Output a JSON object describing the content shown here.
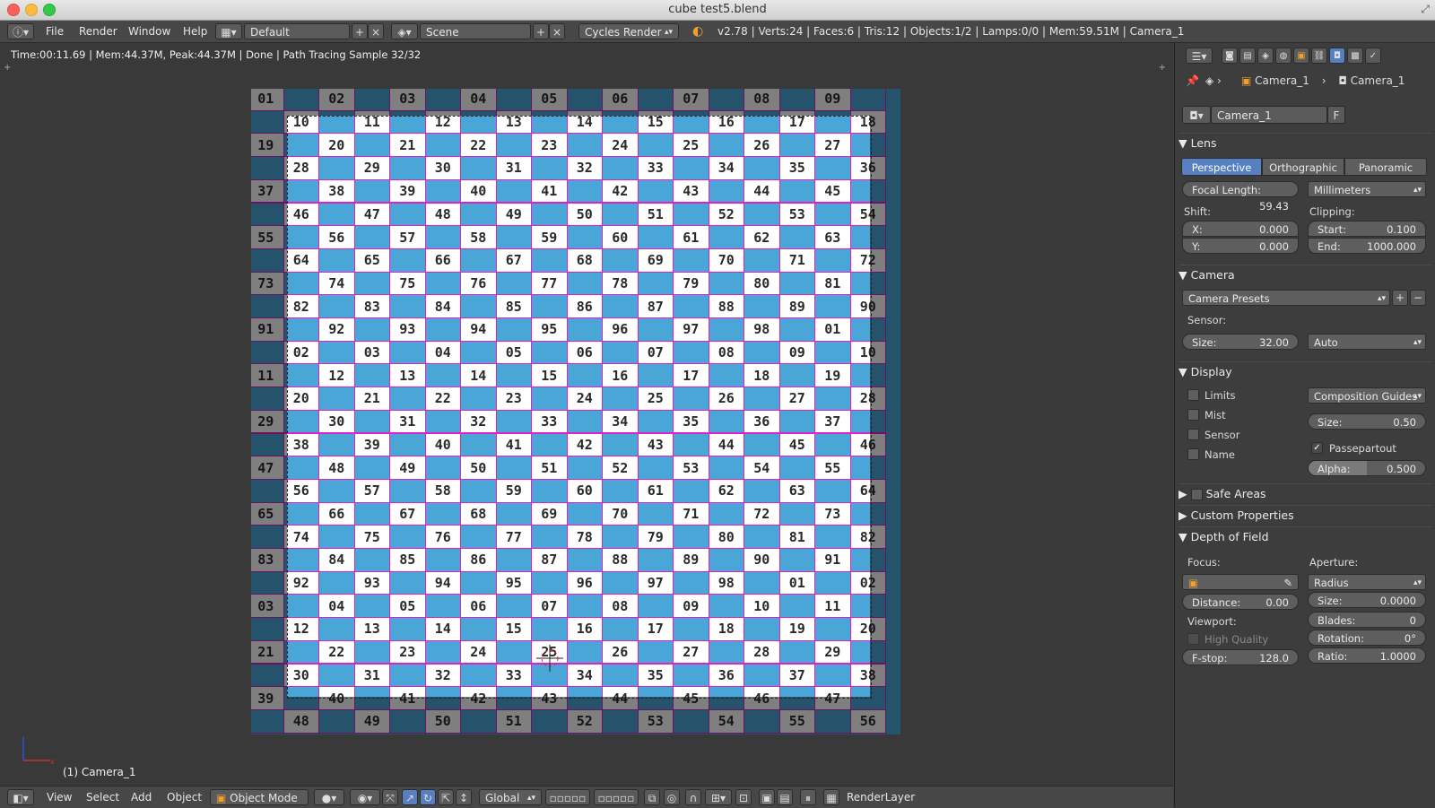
{
  "window": {
    "title": "cube test5.blend"
  },
  "infobar": {
    "menus": [
      "File",
      "Render",
      "Window",
      "Help"
    ],
    "layout": "Default",
    "scene": "Scene",
    "engine": "Cycles Render",
    "stats": "v2.78 | Verts:24 | Faces:6 | Tris:12 | Objects:1/2 | Lamps:0/0 | Mem:59.51M | Camera_1"
  },
  "viewport": {
    "status": "Time:00:11.69 | Mem:44.37M, Peak:44.37M | Done | Path Tracing Sample 32/32",
    "object_label": "(1) Camera_1",
    "grid_numbers": [
      "01",
      "02",
      "03",
      "04",
      "05",
      "06",
      "07",
      "08",
      "09",
      "10",
      "11",
      "12",
      "13",
      "14",
      "15",
      "16",
      "17",
      "18",
      "19",
      "20",
      "21",
      "22",
      "23",
      "24",
      "25",
      "26",
      "27",
      "28",
      "29",
      "30",
      "31",
      "32",
      "33",
      "34",
      "35",
      "36",
      "37",
      "38",
      "39",
      "40",
      "41",
      "42",
      "43",
      "44",
      "45",
      "46",
      "47",
      "48",
      "49",
      "50",
      "51",
      "52",
      "53",
      "54",
      "55",
      "56",
      "57",
      "58",
      "59",
      "60",
      "61",
      "62",
      "63",
      "64",
      "65",
      "66",
      "67",
      "68",
      "69",
      "70",
      "71",
      "72",
      "73",
      "74",
      "75",
      "76",
      "77",
      "78",
      "79",
      "80",
      "81",
      "82",
      "83",
      "84",
      "85",
      "86",
      "87",
      "88",
      "89",
      "90",
      "91",
      "92",
      "93",
      "94",
      "95",
      "96",
      "97",
      "98"
    ]
  },
  "bottombar": {
    "menus": [
      "View",
      "Select",
      "Add",
      "Object"
    ],
    "mode": "Object Mode",
    "orientation": "Global",
    "layer": "RenderLayer"
  },
  "properties": {
    "breadcrumb": [
      "Camera_1",
      "Camera_1"
    ],
    "datablock": "Camera_1",
    "fake_user": "F",
    "lens": {
      "header": "Lens",
      "tabs": [
        "Perspective",
        "Orthographic",
        "Panoramic"
      ],
      "active_tab": "Perspective",
      "focal_length_label": "Focal Length:",
      "focal_length": "59.43",
      "units": "Millimeters",
      "shift_label": "Shift:",
      "shift_x_label": "X:",
      "shift_x": "0.000",
      "shift_y_label": "Y:",
      "shift_y": "0.000",
      "clipping_label": "Clipping:",
      "clip_start_label": "Start:",
      "clip_start": "0.100",
      "clip_end_label": "End:",
      "clip_end": "1000.000"
    },
    "camera": {
      "header": "Camera",
      "presets": "Camera Presets",
      "sensor_label": "Sensor:",
      "size_label": "Size:",
      "size": "32.00",
      "fit": "Auto"
    },
    "display": {
      "header": "Display",
      "limits": "Limits",
      "mist": "Mist",
      "sensor": "Sensor",
      "name": "Name",
      "guides": "Composition Guides",
      "size_label": "Size:",
      "size": "0.50",
      "passepartout": "Passepartout",
      "alpha_label": "Alpha:",
      "alpha": "0.500"
    },
    "safe_areas": "Safe Areas",
    "custom_properties": "Custom Properties",
    "dof": {
      "header": "Depth of Field",
      "focus_label": "Focus:",
      "distance_label": "Distance:",
      "distance": "0.00",
      "viewport_label": "Viewport:",
      "high_quality": "High Quality",
      "fstop_label": "F-stop:",
      "fstop": "128.0",
      "aperture_label": "Aperture:",
      "aperture_type": "Radius",
      "size_label": "Size:",
      "size": "0.0000",
      "blades_label": "Blades:",
      "blades": "0",
      "rotation_label": "Rotation:",
      "rotation": "0°",
      "ratio_label": "Ratio:",
      "ratio": "1.0000"
    }
  }
}
